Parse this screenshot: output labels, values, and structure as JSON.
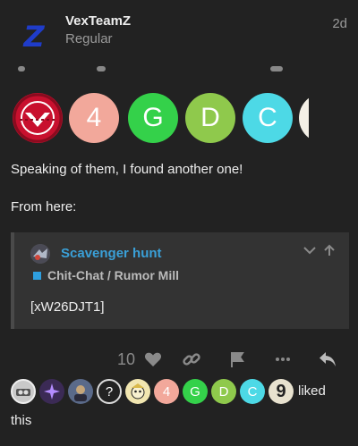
{
  "post": {
    "username": "VexTeamZ",
    "user_title": "Regular",
    "date": "2d",
    "avatar_letter": "Z",
    "paragraph1": "Speaking of them, I found another one!",
    "paragraph2": "From here:"
  },
  "badges": [
    {
      "icon": "vex-logo-icon",
      "label": "",
      "color": "#c8102e"
    },
    {
      "icon": "letter-badge",
      "label": "4",
      "color": "#f2a89b"
    },
    {
      "icon": "letter-badge",
      "label": "G",
      "color": "#34d14a"
    },
    {
      "icon": "letter-badge",
      "label": "D",
      "color": "#8fc94c"
    },
    {
      "icon": "letter-badge",
      "label": "C",
      "color": "#4dd9e6"
    }
  ],
  "quote": {
    "title": "Scavenger hunt",
    "category": "Chit-Chat / Rumor Mill",
    "category_color": "#2e9fdf",
    "body": "[xW26DJT1]"
  },
  "actions": {
    "like_count": "10"
  },
  "likers": {
    "avatars": [
      {
        "label": "",
        "color": "#c9c9c9"
      },
      {
        "label": "",
        "color": "#3b2a55"
      },
      {
        "label": "",
        "color": "#5a6a8a"
      },
      {
        "label": "?",
        "color": "#222222"
      },
      {
        "label": "",
        "color": "#f1e6b0"
      },
      {
        "label": "4",
        "color": "#f2a89b"
      },
      {
        "label": "G",
        "color": "#34d14a"
      },
      {
        "label": "D",
        "color": "#8fc94c"
      },
      {
        "label": "C",
        "color": "#4dd9e6"
      },
      {
        "label": "9",
        "color": "#e8e2cf"
      }
    ],
    "liked": "liked",
    "this": "this"
  }
}
